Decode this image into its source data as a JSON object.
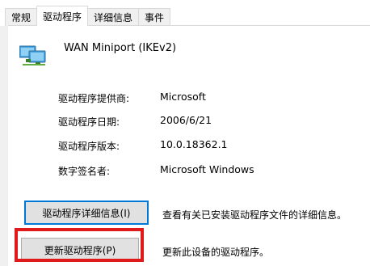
{
  "tabs": [
    {
      "label": "常规",
      "active": false
    },
    {
      "label": "驱动程序",
      "active": true
    },
    {
      "label": "详细信息",
      "active": false
    },
    {
      "label": "事件",
      "active": false
    }
  ],
  "device": {
    "name": "WAN Miniport (IKEv2)",
    "icon": "network-adapter-icon"
  },
  "properties": [
    {
      "label": "驱动程序提供商:",
      "value": "Microsoft"
    },
    {
      "label": "驱动程序日期:",
      "value": "2006/6/21"
    },
    {
      "label": "驱动程序版本:",
      "value": "10.0.18362.1"
    },
    {
      "label": "数字签名者:",
      "value": "Microsoft Windows"
    }
  ],
  "actions": [
    {
      "button": "驱动程序详细信息(I)",
      "description": "查看有关已安装驱动程序文件的详细信息。"
    },
    {
      "button": "更新驱动程序(P)",
      "description": "更新此设备的驱动程序。"
    }
  ],
  "colors": {
    "highlight": "#e01a1a",
    "focus": "#0078d7",
    "button_face": "#e1e1e1"
  }
}
